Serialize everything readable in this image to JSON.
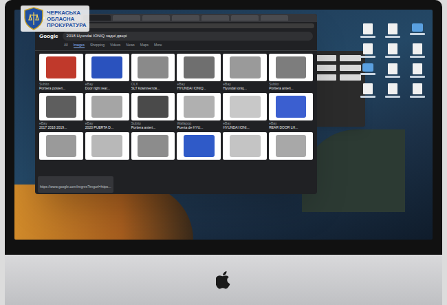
{
  "watermark": {
    "lines": [
      "ЧЕРКАСЬКА",
      "ОБЛАСНА",
      "ПРОКУРАТУРА"
    ]
  },
  "browser": {
    "tabs": [
      {
        "selected": false
      },
      {
        "selected": true
      },
      {
        "selected": false
      },
      {
        "selected": false
      },
      {
        "selected": false
      },
      {
        "selected": false
      },
      {
        "selected": false
      },
      {
        "selected": false
      }
    ],
    "logo": "Google",
    "query": "2018 Hyundai IONIQ задні двері",
    "filters": [
      {
        "label": "All",
        "selected": false
      },
      {
        "label": "Images",
        "selected": true
      },
      {
        "label": "Shopping",
        "selected": false
      },
      {
        "label": "Videos",
        "selected": false
      },
      {
        "label": "News",
        "selected": false
      },
      {
        "label": "Maps",
        "selected": false
      },
      {
        "label": "More",
        "selected": false
      }
    ],
    "results": [
      {
        "source": "Subito",
        "title": "Portiera posteri...",
        "color": "#c0392b"
      },
      {
        "source": "eBay",
        "title": "Door right rear...",
        "color": "#2a52be"
      },
      {
        "source": "OLX",
        "title": "SLT Комплектов...",
        "color": "#8a8a8a"
      },
      {
        "source": "eBay",
        "title": "HYUNDAI IONIQ...",
        "color": "#6f6f6f"
      },
      {
        "source": "eBay",
        "title": "Hyundai ioniq...",
        "color": "#9a9a9a"
      },
      {
        "source": "Subito",
        "title": "Portiera anteri...",
        "color": "#7d7d7d"
      },
      {
        "source": "eBay",
        "title": "2017 2018 2019...",
        "color": "#5e5e5e"
      },
      {
        "source": "eBay",
        "title": "2020 PUERTA D...",
        "color": "#a5a5a5"
      },
      {
        "source": "Subito",
        "title": "Portiera anteri...",
        "color": "#4a4a4a"
      },
      {
        "source": "Wallapop",
        "title": "Puerta de HYU...",
        "color": "#b0b0b0"
      },
      {
        "source": "eBay",
        "title": "HYUNDAI IONI...",
        "color": "#c8c8c8"
      },
      {
        "source": "eBay",
        "title": "REAR DOOR LH...",
        "color": "#3b5fd0"
      }
    ],
    "partial_row": [
      "#9a9a9a",
      "#b8b8b8",
      "#8c8c8c",
      "#2f5ac8",
      "#c4c4c4",
      "#a8a8a8"
    ],
    "status_url": "https://www.google.com/imgres?imgurl=https..."
  },
  "desktop_icons": [
    {
      "kind": "file"
    },
    {
      "kind": "file"
    },
    {
      "kind": "folder"
    },
    {
      "kind": "file"
    },
    {
      "kind": "file"
    },
    {
      "kind": "file"
    },
    {
      "kind": "folder"
    },
    {
      "kind": "file"
    },
    {
      "kind": "file"
    },
    {
      "kind": "file"
    },
    {
      "kind": "file"
    },
    {
      "kind": "file"
    }
  ]
}
